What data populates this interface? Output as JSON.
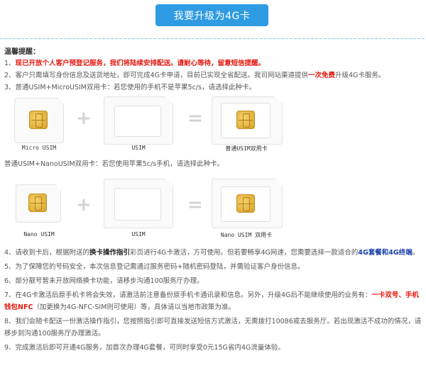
{
  "header": {
    "upgrade_button": "我要升级为4G卡"
  },
  "notice": {
    "title": "温馨提醒：",
    "item1_num": "1、",
    "item1_text": "现已开放个人客户预登记服务，我们将陆续安排配送。请耐心等待，留意短信提醒。",
    "item2_a": "2、客户只需填写身份信息及送货地址，即可完成4G卡申请，目前已实现全省配送。我司网站渠道提供",
    "item2_b": "一次免费",
    "item2_c": "升级4G卡服务。",
    "item3": "3、普通USIM+MicroUSIM双用卡：若您使用的手机不是苹果5c/s，请选择此种卡。",
    "row1": {
      "left": "Micro USIM",
      "mid": "USIM",
      "right": "普通USIM双用卡",
      "plus": "+",
      "eq": "="
    },
    "item3b": "普通USIM+NanoUSIM双用卡：若您使用苹果5c/s手机，请选择此种卡。",
    "row2": {
      "left": "Nano USIM",
      "mid": "USIM",
      "right": "Nano USIM 双用卡",
      "plus": "+",
      "eq": "="
    },
    "item4_a": "4、请收到卡后，根据附送的",
    "item4_b": "换卡操作指引",
    "item4_c": "彩页进行4G卡激活，方可使用。但若要畅享4G网速，您需要选择一款适合的",
    "item4_d": "4G套餐和4G终端",
    "item4_e": "。",
    "item5": "5、为了保障您的号码安全，本次信息登记需通过服务密码+随机密码登陆，并需验证客户身份信息。",
    "item6": "6、部分靓号暂未开放网络换卡功能，请移步沟通100服务厅办理。",
    "item7_a": "7、在4G卡激活后原手机卡将会失效，请激活前注意备份原手机卡通讯录和信息。另外，升级4G后不能继续使用的业务有：",
    "item7_b": "一卡双号、手机钱包NFC",
    "item7_c": "（加更换为4G-NFC-SIM则可使用）等，具体请以当地市政策为准。",
    "item8": "8、我们会随卡配送一份激活操作指引，您按照指引即可直接发送短信方式激活，无需拨打10086或去服务厅。若出现激活不成功的情况，请移步到沟通100服务厅办理激活。",
    "item9": "9、完成激活后即可开通4G服务，加首次办理4G套餐，可同时享受0元15G省内4G流量体验。"
  }
}
